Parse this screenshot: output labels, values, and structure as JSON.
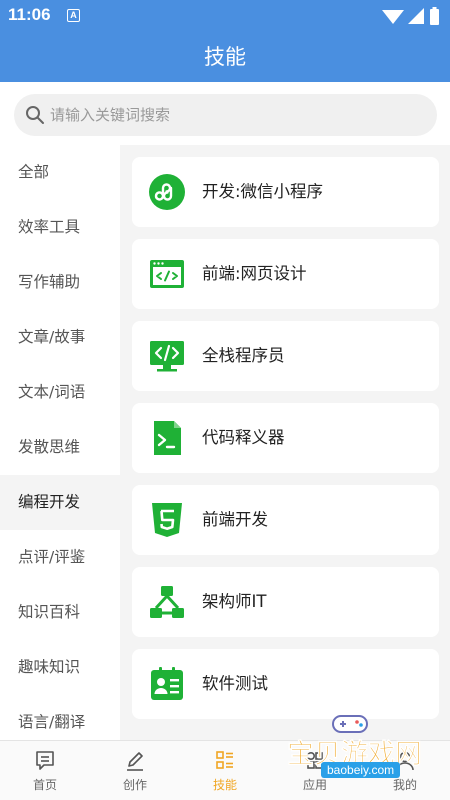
{
  "status": {
    "time": "11:06",
    "notif_letter": "A"
  },
  "header": {
    "title": "技能"
  },
  "search": {
    "placeholder": "请输入关键词搜索"
  },
  "sidebar": {
    "items": [
      {
        "label": "全部"
      },
      {
        "label": "效率工具"
      },
      {
        "label": "写作辅助"
      },
      {
        "label": "文章/故事"
      },
      {
        "label": "文本/词语"
      },
      {
        "label": "发散思维"
      },
      {
        "label": "编程开发",
        "active": true
      },
      {
        "label": "点评/评鉴"
      },
      {
        "label": "知识百科"
      },
      {
        "label": "趣味知识"
      },
      {
        "label": "语言/翻译"
      }
    ]
  },
  "skills": [
    {
      "label": "开发:微信小程序",
      "icon": "miniprogram-icon"
    },
    {
      "label": "前端:网页设计",
      "icon": "webpage-code-icon"
    },
    {
      "label": "全栈程序员",
      "icon": "monitor-code-icon"
    },
    {
      "label": "代码释义器",
      "icon": "terminal-file-icon"
    },
    {
      "label": "前端开发",
      "icon": "html5-icon"
    },
    {
      "label": "架构师IT",
      "icon": "architecture-icon"
    },
    {
      "label": "软件测试",
      "icon": "test-badge-icon"
    }
  ],
  "tabs": [
    {
      "label": "首页",
      "icon": "home-chat-icon"
    },
    {
      "label": "创作",
      "icon": "pen-icon"
    },
    {
      "label": "技能",
      "icon": "list-icon",
      "active": true
    },
    {
      "label": "应用",
      "icon": "grid-icon"
    },
    {
      "label": "我的",
      "icon": "person-icon"
    }
  ],
  "watermark": {
    "text": "宝贝游戏网",
    "url": "baobeiy.com"
  },
  "colors": {
    "primary": "#4a8fe0",
    "icon_green": "#1fb136",
    "tab_active": "#f0a623"
  }
}
